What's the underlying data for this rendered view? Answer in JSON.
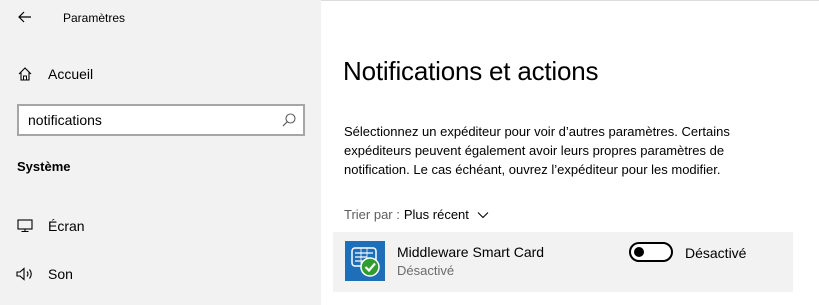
{
  "window": {
    "title": "Paramètres"
  },
  "sidebar": {
    "home_label": "Accueil",
    "search": {
      "value": "notifications",
      "placeholder": ""
    },
    "section_header": "Système",
    "items": [
      {
        "label": "Écran",
        "icon": "monitor-icon"
      },
      {
        "label": "Son",
        "icon": "speaker-icon"
      }
    ]
  },
  "main": {
    "title": "Notifications et actions",
    "description": "Sélectionnez un expéditeur pour voir d’autres paramètres. Certains expéditeurs peuvent également avoir leurs propres paramètres de notification. Le cas échéant, ouvrez l’expéditeur pour les modifier.",
    "sort": {
      "label": "Trier par :",
      "value": "Plus récent"
    },
    "senders": [
      {
        "name": "Middleware Smart Card",
        "status": "Désactivé",
        "toggle_label": "Désactivé",
        "toggle_on": false,
        "icon_color": "#1e6fb8",
        "badge_color": "#2e9e2e"
      }
    ]
  }
}
